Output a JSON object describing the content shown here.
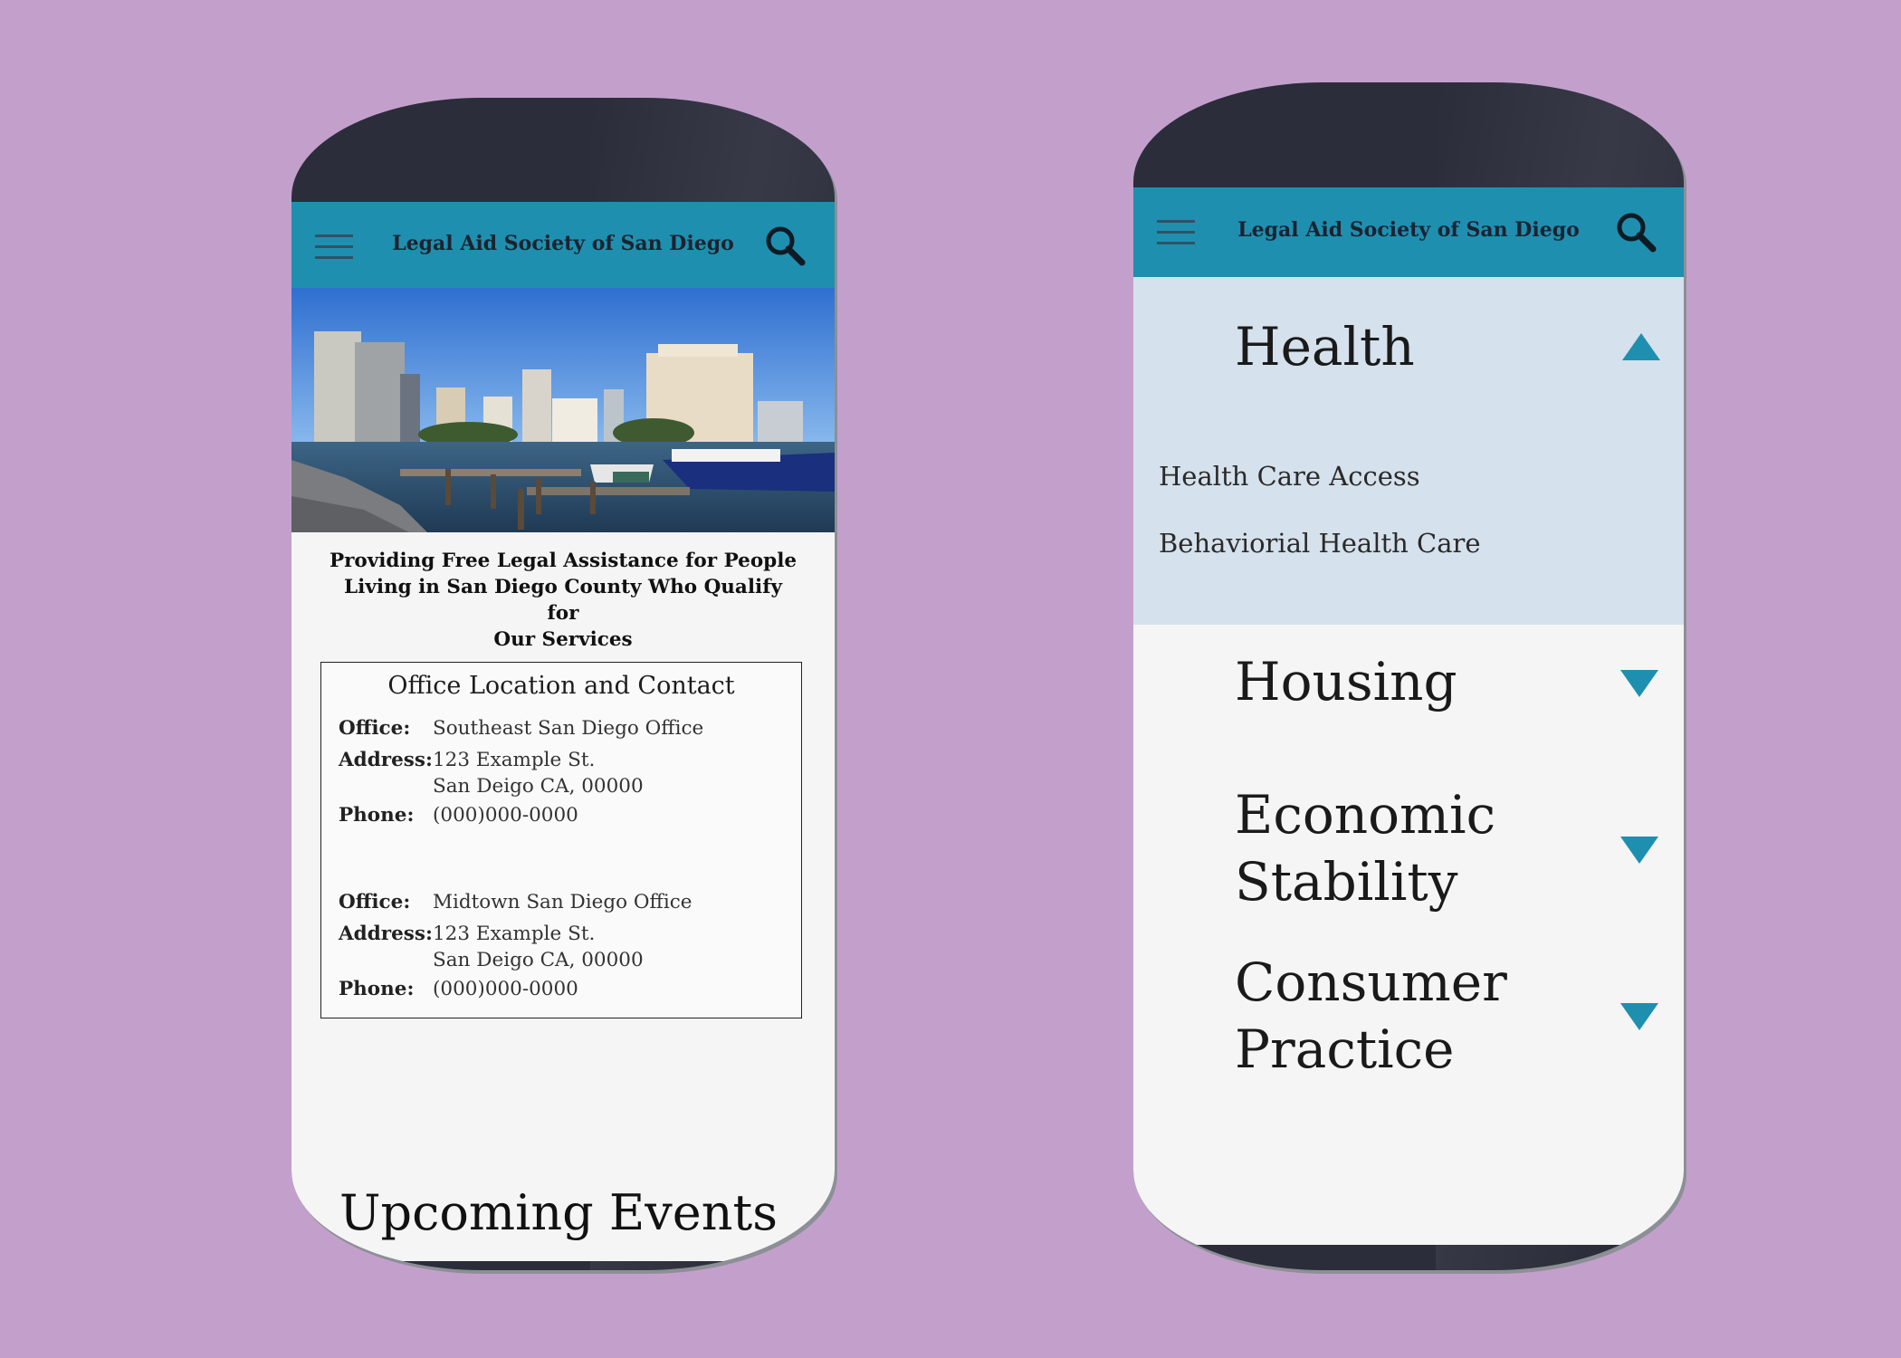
{
  "colors": {
    "background": "#c3a0cc",
    "brand_header": "#1f8fb0",
    "phone_body": "#2b2d3b",
    "accordion_open_bg": "#d5e1ec"
  },
  "header": {
    "title": "Legal Aid Society of San Diego",
    "menu_icon": "hamburger-menu-icon",
    "search_icon": "search-icon"
  },
  "home": {
    "hero_image": "san-diego-marina-skyline",
    "tagline_lines": [
      "Providing Free Legal Assistance for People",
      "Living in San Diego County Who Qualify for",
      "Our Services"
    ],
    "contact": {
      "title": "Office Location and Contact",
      "labels": {
        "office": "Office:",
        "address": "Address:",
        "phone": "Phone:"
      },
      "offices": [
        {
          "office": "Southeast San Diego Office",
          "address_line1": "123 Example St.",
          "address_line2": "San Deigo CA, 00000",
          "phone": "(000)000-0000"
        },
        {
          "office": "Midtown San Diego Office",
          "address_line1": "123 Example St.",
          "address_line2": "San Deigo CA, 00000",
          "phone": "(000)000-0000"
        }
      ]
    },
    "events_heading": "Upcoming Events"
  },
  "menu": {
    "sections": [
      {
        "title_lines": [
          "Health"
        ],
        "expanded": true,
        "icon": "triangle-up-icon",
        "items": [
          "Health Care Access",
          "Behaviorial Health Care"
        ]
      },
      {
        "title_lines": [
          "Housing"
        ],
        "expanded": false,
        "icon": "triangle-down-icon"
      },
      {
        "title_lines": [
          "Economic",
          "Stability"
        ],
        "expanded": false,
        "icon": "triangle-down-icon"
      },
      {
        "title_lines": [
          "Consumer",
          "Practice"
        ],
        "expanded": false,
        "icon": "triangle-down-icon"
      }
    ]
  }
}
